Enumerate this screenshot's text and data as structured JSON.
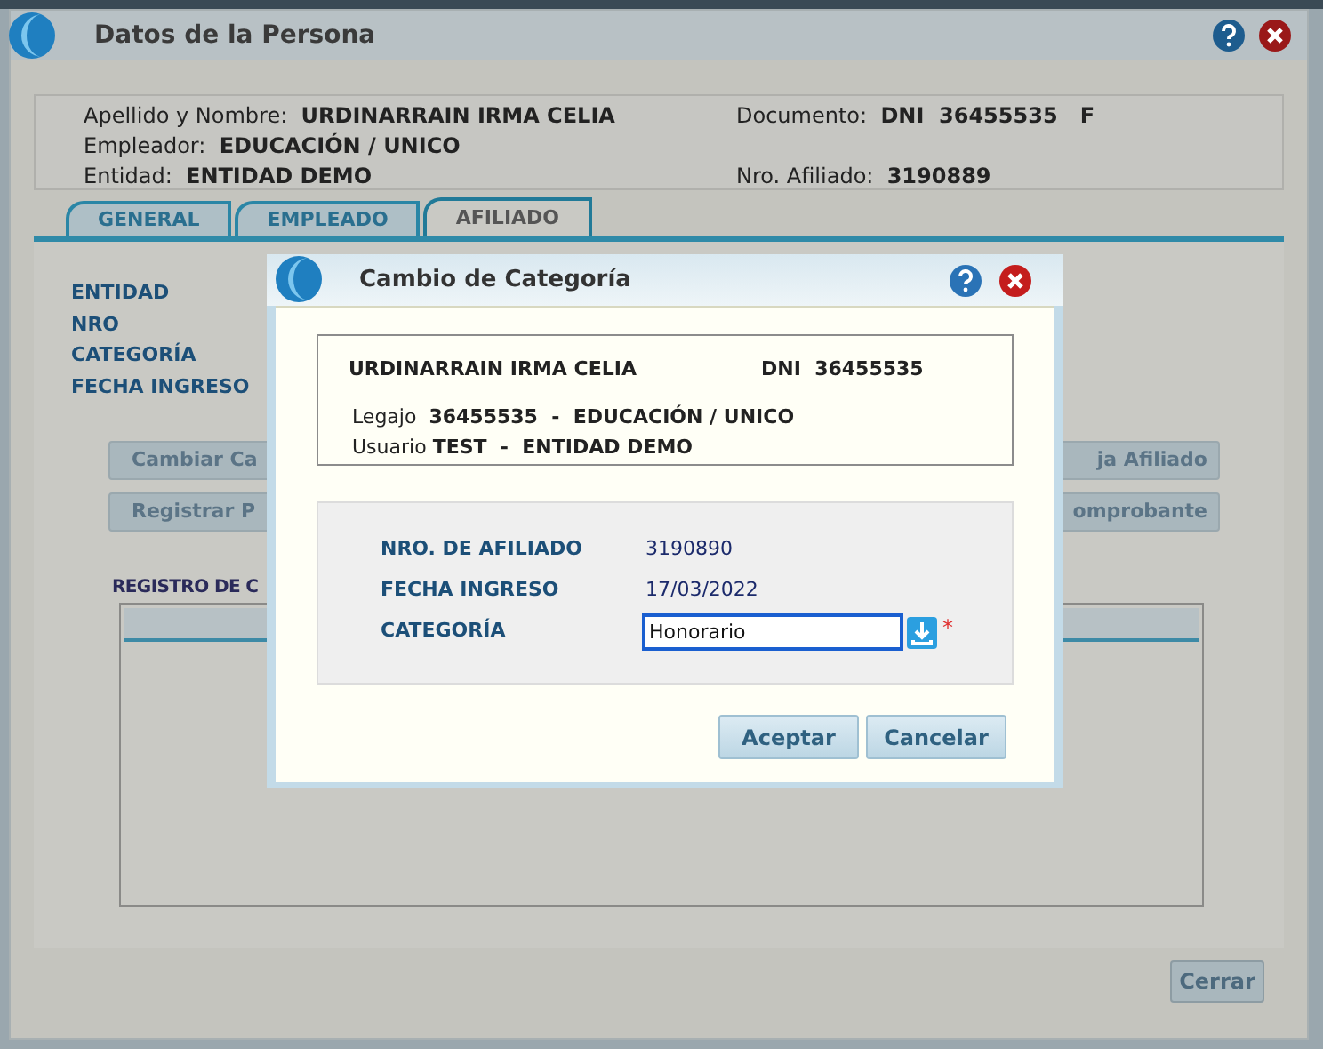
{
  "window": {
    "title": "Datos de la Persona"
  },
  "person": [
    {
      "label": "Apellido y Nombre:",
      "value": "URDINARRAIN IRMA CELIA"
    },
    {
      "label": "Documento:",
      "value": "DNI  36455535   F"
    },
    {
      "label": "Empleador:",
      "value": "EDUCACIÓN / UNICO"
    },
    {
      "label": "Entidad:",
      "value": "ENTIDAD DEMO"
    },
    {
      "label": "Nro. Afiliado:",
      "value": "3190889"
    }
  ],
  "tabs": [
    {
      "label": "GENERAL",
      "selected": false
    },
    {
      "label": "EMPLEADO",
      "selected": false
    },
    {
      "label": "AFILIADO",
      "selected": true
    }
  ],
  "fields": [
    "ENTIDAD",
    "NRO",
    "CATEGORÍA",
    "FECHA INGRESO"
  ],
  "buttons_left": [
    "Cambiar Ca",
    "Registrar P"
  ],
  "buttons_right": [
    "ja Afiliado",
    "omprobante"
  ],
  "section_title": "REGISTRO DE C",
  "close_button": "Cerrar",
  "dialog": {
    "title": "Cambio de Categoría",
    "name": "URDINARRAIN IRMA CELIA",
    "document": "DNI  36455535",
    "legajo_label": "Legajo",
    "legajo": "36455535  -  EDUCACIÓN / UNICO",
    "usuario_label": "Usuario",
    "usuario": "TEST  -  ENTIDAD DEMO",
    "rows": [
      {
        "label": "NRO. DE AFILIADO",
        "value": "3190890"
      },
      {
        "label": "FECHA INGRESO",
        "value": "17/03/2022"
      }
    ],
    "category": {
      "label": "CATEGORÍA",
      "value": "Honorario",
      "required": true,
      "required_mark": "*"
    },
    "buttons": [
      "Aceptar",
      "Cancelar"
    ]
  }
}
